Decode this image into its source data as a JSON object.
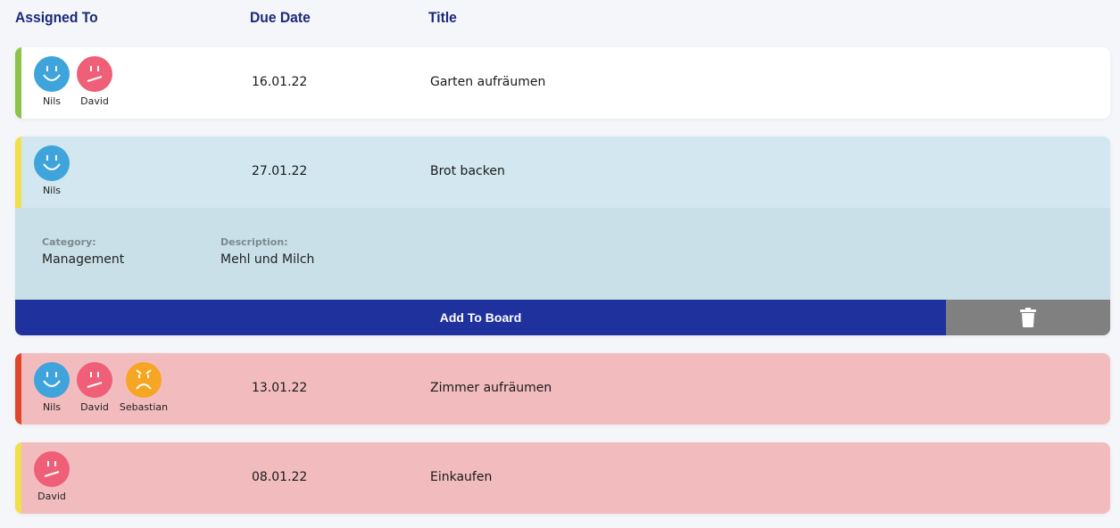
{
  "header": {
    "assigned_to": "Assigned To",
    "due_date": "Due Date",
    "title": "Title"
  },
  "colors": {
    "green": "#8bc34a",
    "yellow": "#f0e04a",
    "red": "#e0462b",
    "blue_face": "#3fa4dc",
    "pink_face": "#ef5f78",
    "orange_face": "#f6a622",
    "primary": "#1f319c"
  },
  "tasks": [
    {
      "assignees": [
        {
          "name": "Nils",
          "mood": "happy"
        },
        {
          "name": "David",
          "mood": "neutral"
        }
      ],
      "due_date": "16.01.22",
      "title": "Garten aufräumen"
    },
    {
      "assignees": [
        {
          "name": "Nils",
          "mood": "happy"
        }
      ],
      "due_date": "27.01.22",
      "title": "Brot backen",
      "details": {
        "category_label": "Category:",
        "category": "Management",
        "description_label": "Description:",
        "description": "Mehl und Milch"
      },
      "add_button": "Add To Board",
      "delete_icon": "trash-icon"
    },
    {
      "assignees": [
        {
          "name": "Nils",
          "mood": "happy"
        },
        {
          "name": "David",
          "mood": "neutral"
        },
        {
          "name": "Sebastian",
          "mood": "angry"
        }
      ],
      "due_date": "13.01.22",
      "title": "Zimmer aufräumen"
    },
    {
      "assignees": [
        {
          "name": "David",
          "mood": "neutral"
        }
      ],
      "due_date": "08.01.22",
      "title": "Einkaufen"
    }
  ]
}
